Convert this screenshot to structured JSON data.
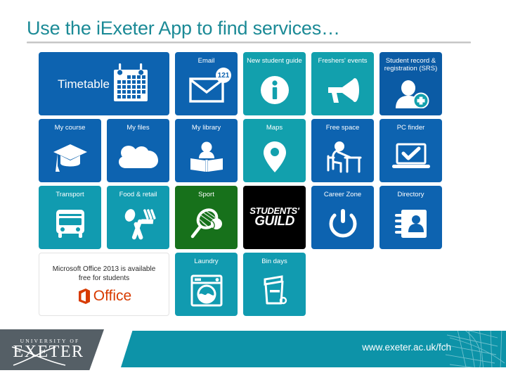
{
  "slide": {
    "title": "Use the i​Exeter App to find services…",
    "title_color": "#1b8a96",
    "background": "#ffffff"
  },
  "colors": {
    "blue": "#0d63b0",
    "blue_dark": "#0b5ba5",
    "teal": "#12a0ad",
    "teal_row3": "#119bb0",
    "green": "#17711b",
    "black": "#000000",
    "white": "#ffffff",
    "office_orange": "#d83b01",
    "footer_gray": "#555f66",
    "footer_teal": "#0d93a8"
  },
  "tiles": {
    "rows": [
      [
        {
          "label": "Timetable",
          "icon": "calendar-icon",
          "color": "#0d63b0",
          "span": 2,
          "style": "wide"
        },
        {
          "label": "Email",
          "icon": "envelope-icon",
          "color": "#0d63b0",
          "badge": "121"
        },
        {
          "label": "New student guide",
          "icon": "info-icon",
          "color": "#12a0ad"
        },
        {
          "label": "Freshers' events",
          "icon": "megaphone-icon",
          "color": "#12a0ad"
        },
        {
          "label": "Student record & registration (SRS)",
          "icon": "add-person-icon",
          "color": "#0b5ba5"
        }
      ],
      [
        {
          "label": "My course",
          "icon": "graduation-cap-icon",
          "color": "#0d63b0"
        },
        {
          "label": "My files",
          "icon": "cloud-icon",
          "color": "#0d63b0"
        },
        {
          "label": "My library",
          "icon": "person-reading-book-icon",
          "color": "#0d63b0"
        },
        {
          "label": "Maps",
          "icon": "map-pin-icon",
          "color": "#12a0ad"
        },
        {
          "label": "Free space",
          "icon": "person-at-desk-icon",
          "color": "#0d63b0"
        },
        {
          "label": "PC finder",
          "icon": "laptop-check-icon",
          "color": "#0d63b0"
        }
      ],
      [
        {
          "label": "Transport",
          "icon": "bus-icon",
          "color": "#119bb0"
        },
        {
          "label": "Food & retail",
          "icon": "fork-spoon-icon",
          "color": "#119bb0"
        },
        {
          "label": "Sport",
          "icon": "tennis-racket-icon",
          "color": "#17711b"
        },
        {
          "label": "STUDENTS' GUILD",
          "icon": "students-guild-logo",
          "color": "#000000",
          "style": "guild",
          "line1": "STUDENTS'",
          "line2": "GUILD"
        },
        {
          "label": "Career Zone",
          "icon": "power-icon",
          "color": "#0d63b0"
        },
        {
          "label": "Directory",
          "icon": "address-book-icon",
          "color": "#0d63b0"
        }
      ],
      [
        {
          "label": "Microsoft Office 2013 is available free for students",
          "icon": "office-logo",
          "color": "#ffffff",
          "span": 2,
          "style": "office",
          "line1": "Microsoft Office 2013 is available",
          "line2": "free for students",
          "word": "Office"
        },
        {
          "label": "Laundry",
          "icon": "washing-machine-icon",
          "color": "#119bb0"
        },
        {
          "label": "Bin days",
          "icon": "trash-bin-icon",
          "color": "#119bb0"
        }
      ]
    ]
  },
  "footer": {
    "logo_top": "UNIVERSITY OF",
    "logo_main": "EXETER",
    "url": "www.exeter.ac.uk/fch"
  }
}
